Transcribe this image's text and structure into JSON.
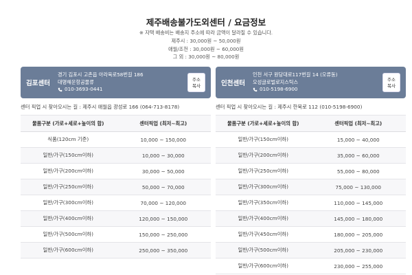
{
  "header": {
    "title": "제주배송불가도외센터 / 요금정보",
    "notice": "※ 자택 배송비는 배송지 주소에 따라 금액이 달라질 수 있습니다.",
    "fees": [
      "제주시 : 30,000원 ~ 50,000원",
      "애월/조천 : 30,000원 ~ 60,000원",
      "그 외 : 30,000원 ~ 80,000원"
    ]
  },
  "centers": [
    {
      "name": "김포센터",
      "address": "경기 김포시 고촌읍 아라육로58번길 186",
      "company": "대명해운항공물류",
      "phone": "010-3693-0441",
      "copy_label_1": "주소",
      "copy_label_2": "복사",
      "pickup": "센터 픽업 시 찾아오시는 길 : 제주시 애월읍 광성로 166 (064-713-8178)",
      "table": {
        "headers": [
          "물품구분 (가로+세로+높이의 합)",
          "센터픽업 (최저~최고)"
        ],
        "rows": [
          [
            "식품(120cm 기준)",
            "10,000 ~ 150,000"
          ],
          [
            "일반/가구(150cm이하)",
            "10,000 ~ 30,000"
          ],
          [
            "일반/가구(200cm이하)",
            "30,000 ~ 50,000"
          ],
          [
            "일반/가구(250cm이하)",
            "50,000 ~ 70,000"
          ],
          [
            "일반/가구(300cm이하)",
            "70,000 ~ 120,000"
          ],
          [
            "일반/가구(400cm이하)",
            "120,000 ~ 150,000"
          ],
          [
            "일반/가구(500cm이하)",
            "150,000 ~ 250,000"
          ],
          [
            "일반/가구(600cm이하)",
            "250,000 ~ 350,000"
          ]
        ]
      }
    },
    {
      "name": "인천센터",
      "address": "인천 서구 원당대로117번길 14 (오류동)",
      "company": "오성글로벌로지스틱스",
      "phone": "010-5198-6900",
      "copy_label_1": "주소",
      "copy_label_2": "복사",
      "pickup": "센터 픽업 시 찾아오시는 길 : 제주시 한북로 112 (010-5198-6900)",
      "table": {
        "headers": [
          "물품구분 (가로+세로+높이의 합)",
          "센터픽업 (최저~최고)"
        ],
        "rows": [
          [
            "일반/가구(150cm이하)",
            "15,000 ~ 40,000"
          ],
          [
            "일반/가구(200cm이하)",
            "35,000 ~ 60,000"
          ],
          [
            "일반/가구(250cm이하)",
            "55,000 ~ 80,000"
          ],
          [
            "일반/가구(300cm이하)",
            "75,000 ~ 130,000"
          ],
          [
            "일반/가구(350cm이하)",
            "110,000 ~ 145,000"
          ],
          [
            "일반/가구(400cm이하)",
            "145,000 ~ 180,000"
          ],
          [
            "일반/가구(450cm이하)",
            "180,000 ~ 205,000"
          ],
          [
            "일반/가구(500cm이하)",
            "205,000 ~ 230,000"
          ],
          [
            "일반/가구(600cm이하)",
            "230,000 ~ 255,000"
          ]
        ]
      }
    }
  ]
}
